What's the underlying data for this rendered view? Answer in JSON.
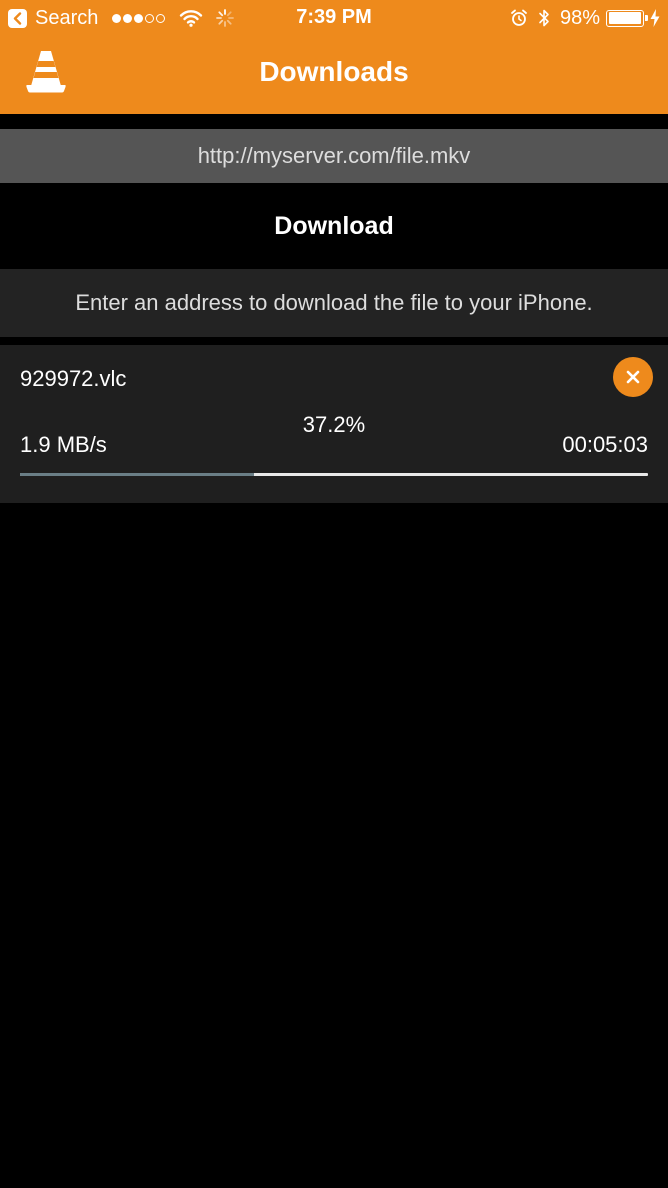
{
  "status_bar": {
    "back_app_label": "Search",
    "signal_bars_filled": 3,
    "signal_bars_total": 5,
    "time": "7:39 PM",
    "battery_percent": "98%",
    "battery_level": 0.98,
    "icons": [
      "back-arrow-icon",
      "wifi-icon",
      "activity-spinner-icon",
      "alarm-icon",
      "bluetooth-icon",
      "battery-icon",
      "charging-bolt-icon"
    ]
  },
  "nav": {
    "title": "Downloads",
    "logo_icon": "vlc-cone-icon"
  },
  "download_form": {
    "url_value": "http://myserver.com/file.mkv",
    "download_label": "Download",
    "hint": "Enter an address to download the file to your iPhone."
  },
  "downloads": [
    {
      "file_name": "929972.vlc",
      "progress_label": "37.2%",
      "progress_fraction": 0.372,
      "speed": "1.9 MB/s",
      "time_remaining": "00:05:03",
      "cancel_icon": "close-icon"
    }
  ],
  "colors": {
    "accent": "#ee8a1c",
    "background": "#000000",
    "url_field_bg": "#555555",
    "hint_bg": "#232323",
    "item_bg": "#1f1f1f",
    "progress_fill": "#6a7e86",
    "progress_track": "#e8e8e8"
  }
}
